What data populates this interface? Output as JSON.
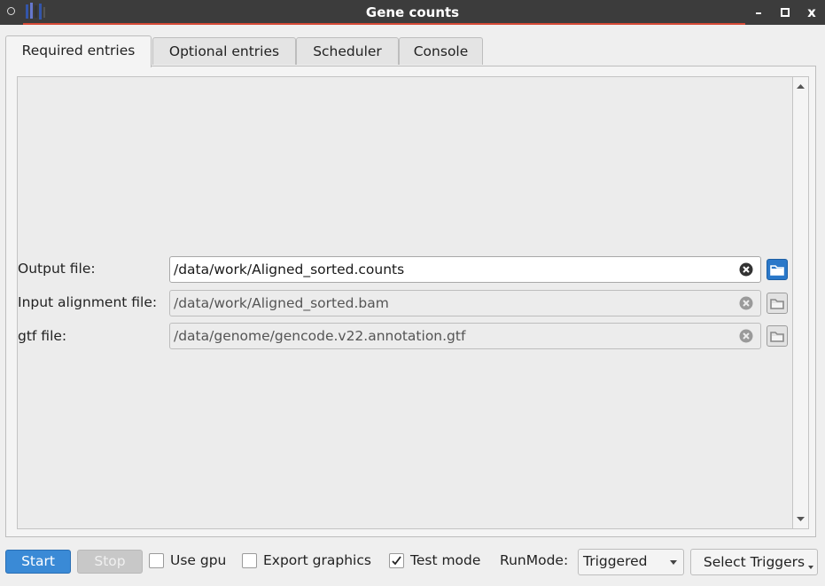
{
  "window": {
    "title": "Gene counts",
    "controls": {
      "minimize": "–",
      "maximize": "□",
      "close": "x"
    }
  },
  "tabs": [
    {
      "label": "Required entries",
      "active": true
    },
    {
      "label": "Optional entries",
      "active": false
    },
    {
      "label": "Scheduler",
      "active": false
    },
    {
      "label": "Console",
      "active": false
    }
  ],
  "fields": [
    {
      "label": "Output file:",
      "value": "/data/work/Aligned_sorted.counts",
      "enabled": true
    },
    {
      "label": "Input alignment file:",
      "value": "/data/work/Aligned_sorted.bam",
      "enabled": false
    },
    {
      "label": "gtf file:",
      "value": "/data/genome/gencode.v22.annotation.gtf",
      "enabled": false
    }
  ],
  "bottom_bar": {
    "start_label": "Start",
    "stop_label": "Stop",
    "use_gpu": {
      "label": "Use gpu",
      "checked": false
    },
    "export_graphics": {
      "label": "Export graphics",
      "checked": false
    },
    "test_mode": {
      "label": "Test mode",
      "checked": true
    },
    "runmode_label": "RunMode:",
    "runmode_value": "Triggered",
    "select_triggers_label": "Select Triggers"
  },
  "colors": {
    "title_bar": "#3c3c3c",
    "title_accent": "#d64a36",
    "start_button": "#3a8ad6",
    "browse_active": "#2a78c9"
  }
}
